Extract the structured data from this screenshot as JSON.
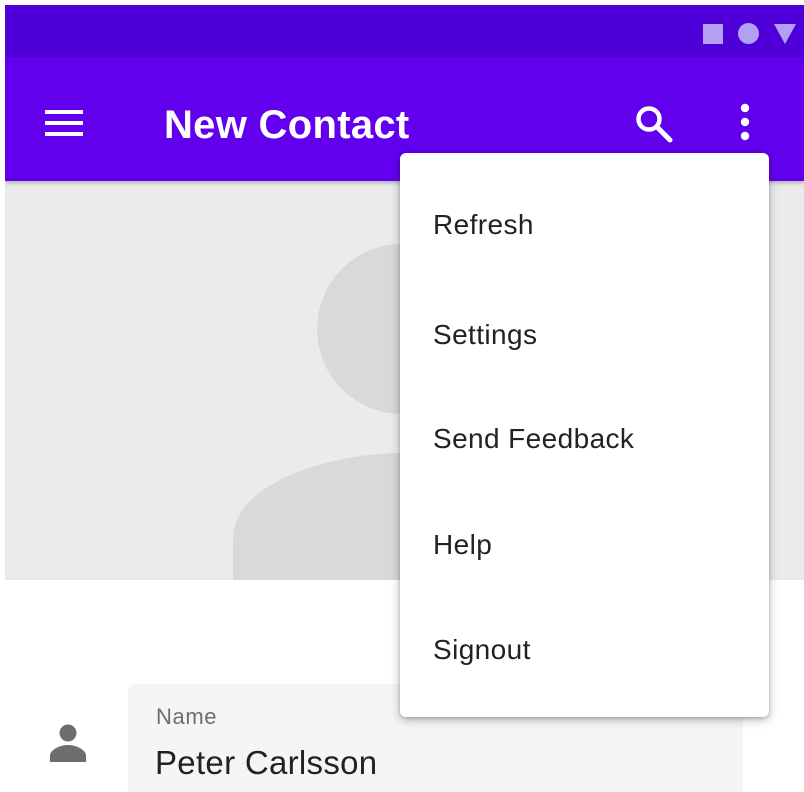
{
  "status_bar": {
    "icons": [
      "square-icon",
      "circle-icon",
      "triangle-icon"
    ],
    "color": "#4f00d9",
    "icon_color": "#b2a1f2"
  },
  "app_bar": {
    "title": "New Contact",
    "color": "#6200ee",
    "navigation_icon": "menu-icon",
    "actions": [
      "search-icon",
      "more-vert-icon"
    ]
  },
  "overflow_menu": {
    "items": [
      {
        "label": "Refresh"
      },
      {
        "label": "Settings"
      },
      {
        "label": "Send Feedback"
      },
      {
        "label": "Help"
      },
      {
        "label": "Signout"
      }
    ]
  },
  "contact_photo": {
    "icon": "person-placeholder-icon",
    "background": "#ebebeb"
  },
  "form": {
    "name": {
      "icon": "person-icon",
      "label": "Name",
      "value": "Peter Carlsson"
    }
  }
}
